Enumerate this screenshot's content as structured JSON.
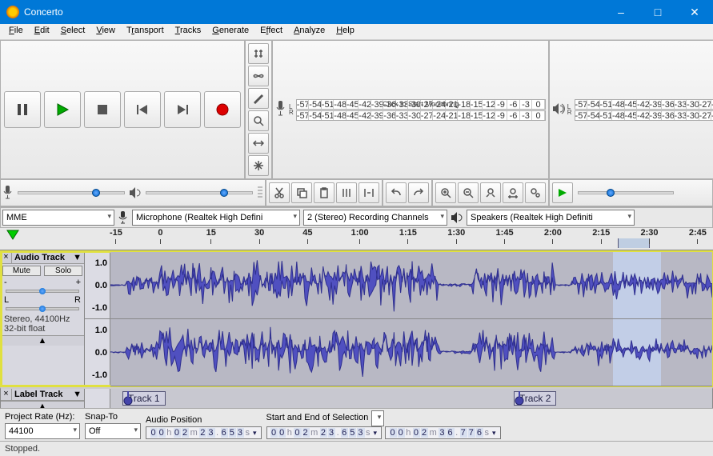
{
  "title": "Concerto",
  "menu": [
    "File",
    "Edit",
    "Select",
    "View",
    "Transport",
    "Tracks",
    "Generate",
    "Effect",
    "Analyze",
    "Help"
  ],
  "menu_accel": [
    0,
    0,
    0,
    0,
    1,
    0,
    0,
    1,
    0,
    0
  ],
  "meter_ticks": [
    "-57",
    "-54",
    "-51",
    "-48",
    "-45",
    "-42",
    "-39",
    "-36",
    "-33",
    "-30",
    "-27",
    "-24",
    "-21",
    "-18",
    "-15",
    "-12",
    "-9",
    "-6",
    "-3",
    "0"
  ],
  "meter_msg": "Click to Start Monitoring",
  "host": "MME",
  "rec_device": "Microphone (Realtek High Defini",
  "channels": "2 (Stereo) Recording Channels",
  "play_device": "Speakers (Realtek High Definiti",
  "timeline": [
    "-15",
    "0",
    "15",
    "30",
    "45",
    "1:00",
    "1:15",
    "1:30",
    "1:45",
    "2:00",
    "2:15",
    "2:30",
    "2:45"
  ],
  "track1": {
    "name": "Audio Track",
    "mute": "Mute",
    "solo": "Solo",
    "info1": "Stereo, 44100Hz",
    "info2": "32-bit float",
    "scale": [
      "1.0",
      "0.0",
      "-1.0"
    ]
  },
  "track2": {
    "name": "Label Track",
    "label1": "Track 1",
    "label2": "Track 2"
  },
  "bottom": {
    "rate_label": "Project Rate (Hz):",
    "rate": "44100",
    "snap_label": "Snap-To",
    "snap": "Off",
    "pos_label": "Audio Position",
    "pos": "00h02m23.653s",
    "sel_label": "Start and End of Selection",
    "sel1": "00h02m23.653s",
    "sel2": "00h02m36.776s"
  },
  "status": "Stopped."
}
